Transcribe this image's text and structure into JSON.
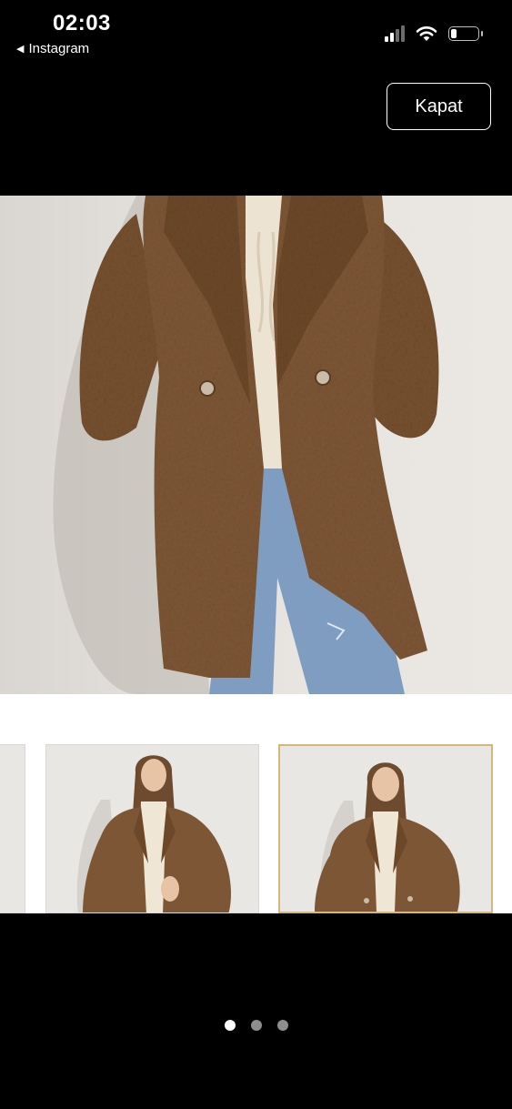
{
  "status_bar": {
    "time": "02:03",
    "back_app": "Instagram",
    "back_icon": "back-triangle-icon",
    "battery_level": 0.2
  },
  "close_button": {
    "label": "Kapat"
  },
  "main_image": {
    "subject": "teddy-coat-photo",
    "colors": {
      "coat": "#7a5334",
      "jeans": "#7e9dc1",
      "sweater": "#ede3d2",
      "wall": "#e6e3de"
    }
  },
  "thumbnails": [
    {
      "state": "partial"
    },
    {
      "state": "default"
    },
    {
      "state": "selected",
      "border_color": "#d6b57e"
    }
  ],
  "pager": {
    "total": 3,
    "active": 0
  }
}
